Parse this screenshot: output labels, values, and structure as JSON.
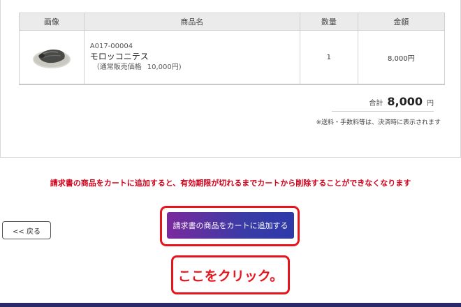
{
  "table": {
    "headers": {
      "image": "画像",
      "name": "商品名",
      "quantity": "数量",
      "amount": "金額"
    },
    "rows": [
      {
        "image_icon": "trilobite-fossil-thumbnail",
        "code": "A017-00004",
        "name": "モロッコニテス",
        "regular_price_label": "（通常販売価格",
        "regular_price_value": "10,000円)",
        "quantity": "1",
        "amount": "8,000円"
      }
    ]
  },
  "summary": {
    "total_label": "合計",
    "total_value": "8,000",
    "total_unit": "円",
    "note": "※送料・手数料等は、決済時に表示されます"
  },
  "warning": "請求書の商品をカートに追加すると、有効期限が切れるまでカートから削除することができなくなります",
  "buttons": {
    "back": "<< 戻る",
    "add_to_cart": "請求書の商品をカートに追加する"
  },
  "callout": "ここをクリック。",
  "colors": {
    "warning": "#d0021b",
    "highlight": "#e8141c",
    "button_gradient_start": "#7a2a9c",
    "button_gradient_end": "#2d3aa8",
    "bottom_bar": "#2a2a6b"
  }
}
